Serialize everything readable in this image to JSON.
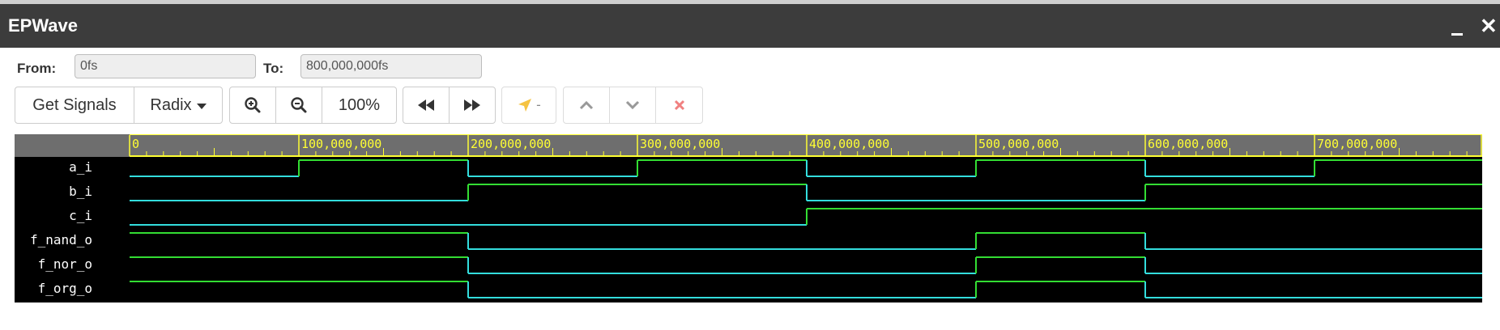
{
  "window": {
    "title": "EPWave",
    "minimize_label": "_",
    "close_label": "✕"
  },
  "range": {
    "from_label": "From:",
    "from_value": "0fs",
    "to_label": "To:",
    "to_value": "800,000,000fs"
  },
  "toolbar": {
    "get_signals_label": "Get Signals",
    "radix_label": "Radix",
    "zoom_level": "100%",
    "cursor_label": "-",
    "icons": [
      "zoom-in-icon",
      "zoom-out-icon",
      "rewind-icon",
      "fast-forward-icon",
      "cursor-arrow-icon",
      "chevron-up-icon",
      "chevron-down-icon",
      "close-icon"
    ]
  },
  "colors": {
    "title_bar": "#3c3c3c",
    "timeline_bg": "#6e6e6e",
    "timeline_text": "#ffff33",
    "wave_low": "#33dddd",
    "wave_high": "#33dd33",
    "delete_red": "#e74c3c"
  },
  "timeline": {
    "units": "fs",
    "range": [
      0,
      800000000
    ],
    "major_ticks": [
      {
        "value": 0,
        "label": "0"
      },
      {
        "value": 100000000,
        "label": "100,000,000"
      },
      {
        "value": 200000000,
        "label": "200,000,000"
      },
      {
        "value": 300000000,
        "label": "300,000,000"
      },
      {
        "value": 400000000,
        "label": "400,000,000"
      },
      {
        "value": 500000000,
        "label": "500,000,000"
      },
      {
        "value": 600000000,
        "label": "600,000,000"
      },
      {
        "value": 700000000,
        "label": "700,000,000"
      }
    ],
    "minor_per_major": 10
  },
  "signals": [
    {
      "name": "a_i",
      "initial": 0,
      "transitions": [
        100000000,
        200000000,
        300000000,
        400000000,
        500000000,
        600000000,
        700000000
      ]
    },
    {
      "name": "b_i",
      "initial": 0,
      "transitions": [
        200000000,
        400000000,
        600000000
      ]
    },
    {
      "name": "c_i",
      "initial": 0,
      "transitions": [
        400000000
      ]
    },
    {
      "name": "f_nand_o",
      "initial": 1,
      "transitions": [
        200000000,
        500000000,
        600000000
      ]
    },
    {
      "name": "f_nor_o",
      "initial": 1,
      "transitions": [
        200000000,
        500000000,
        600000000
      ]
    },
    {
      "name": "f_org_o",
      "initial": 1,
      "transitions": [
        200000000,
        500000000,
        600000000
      ]
    }
  ]
}
